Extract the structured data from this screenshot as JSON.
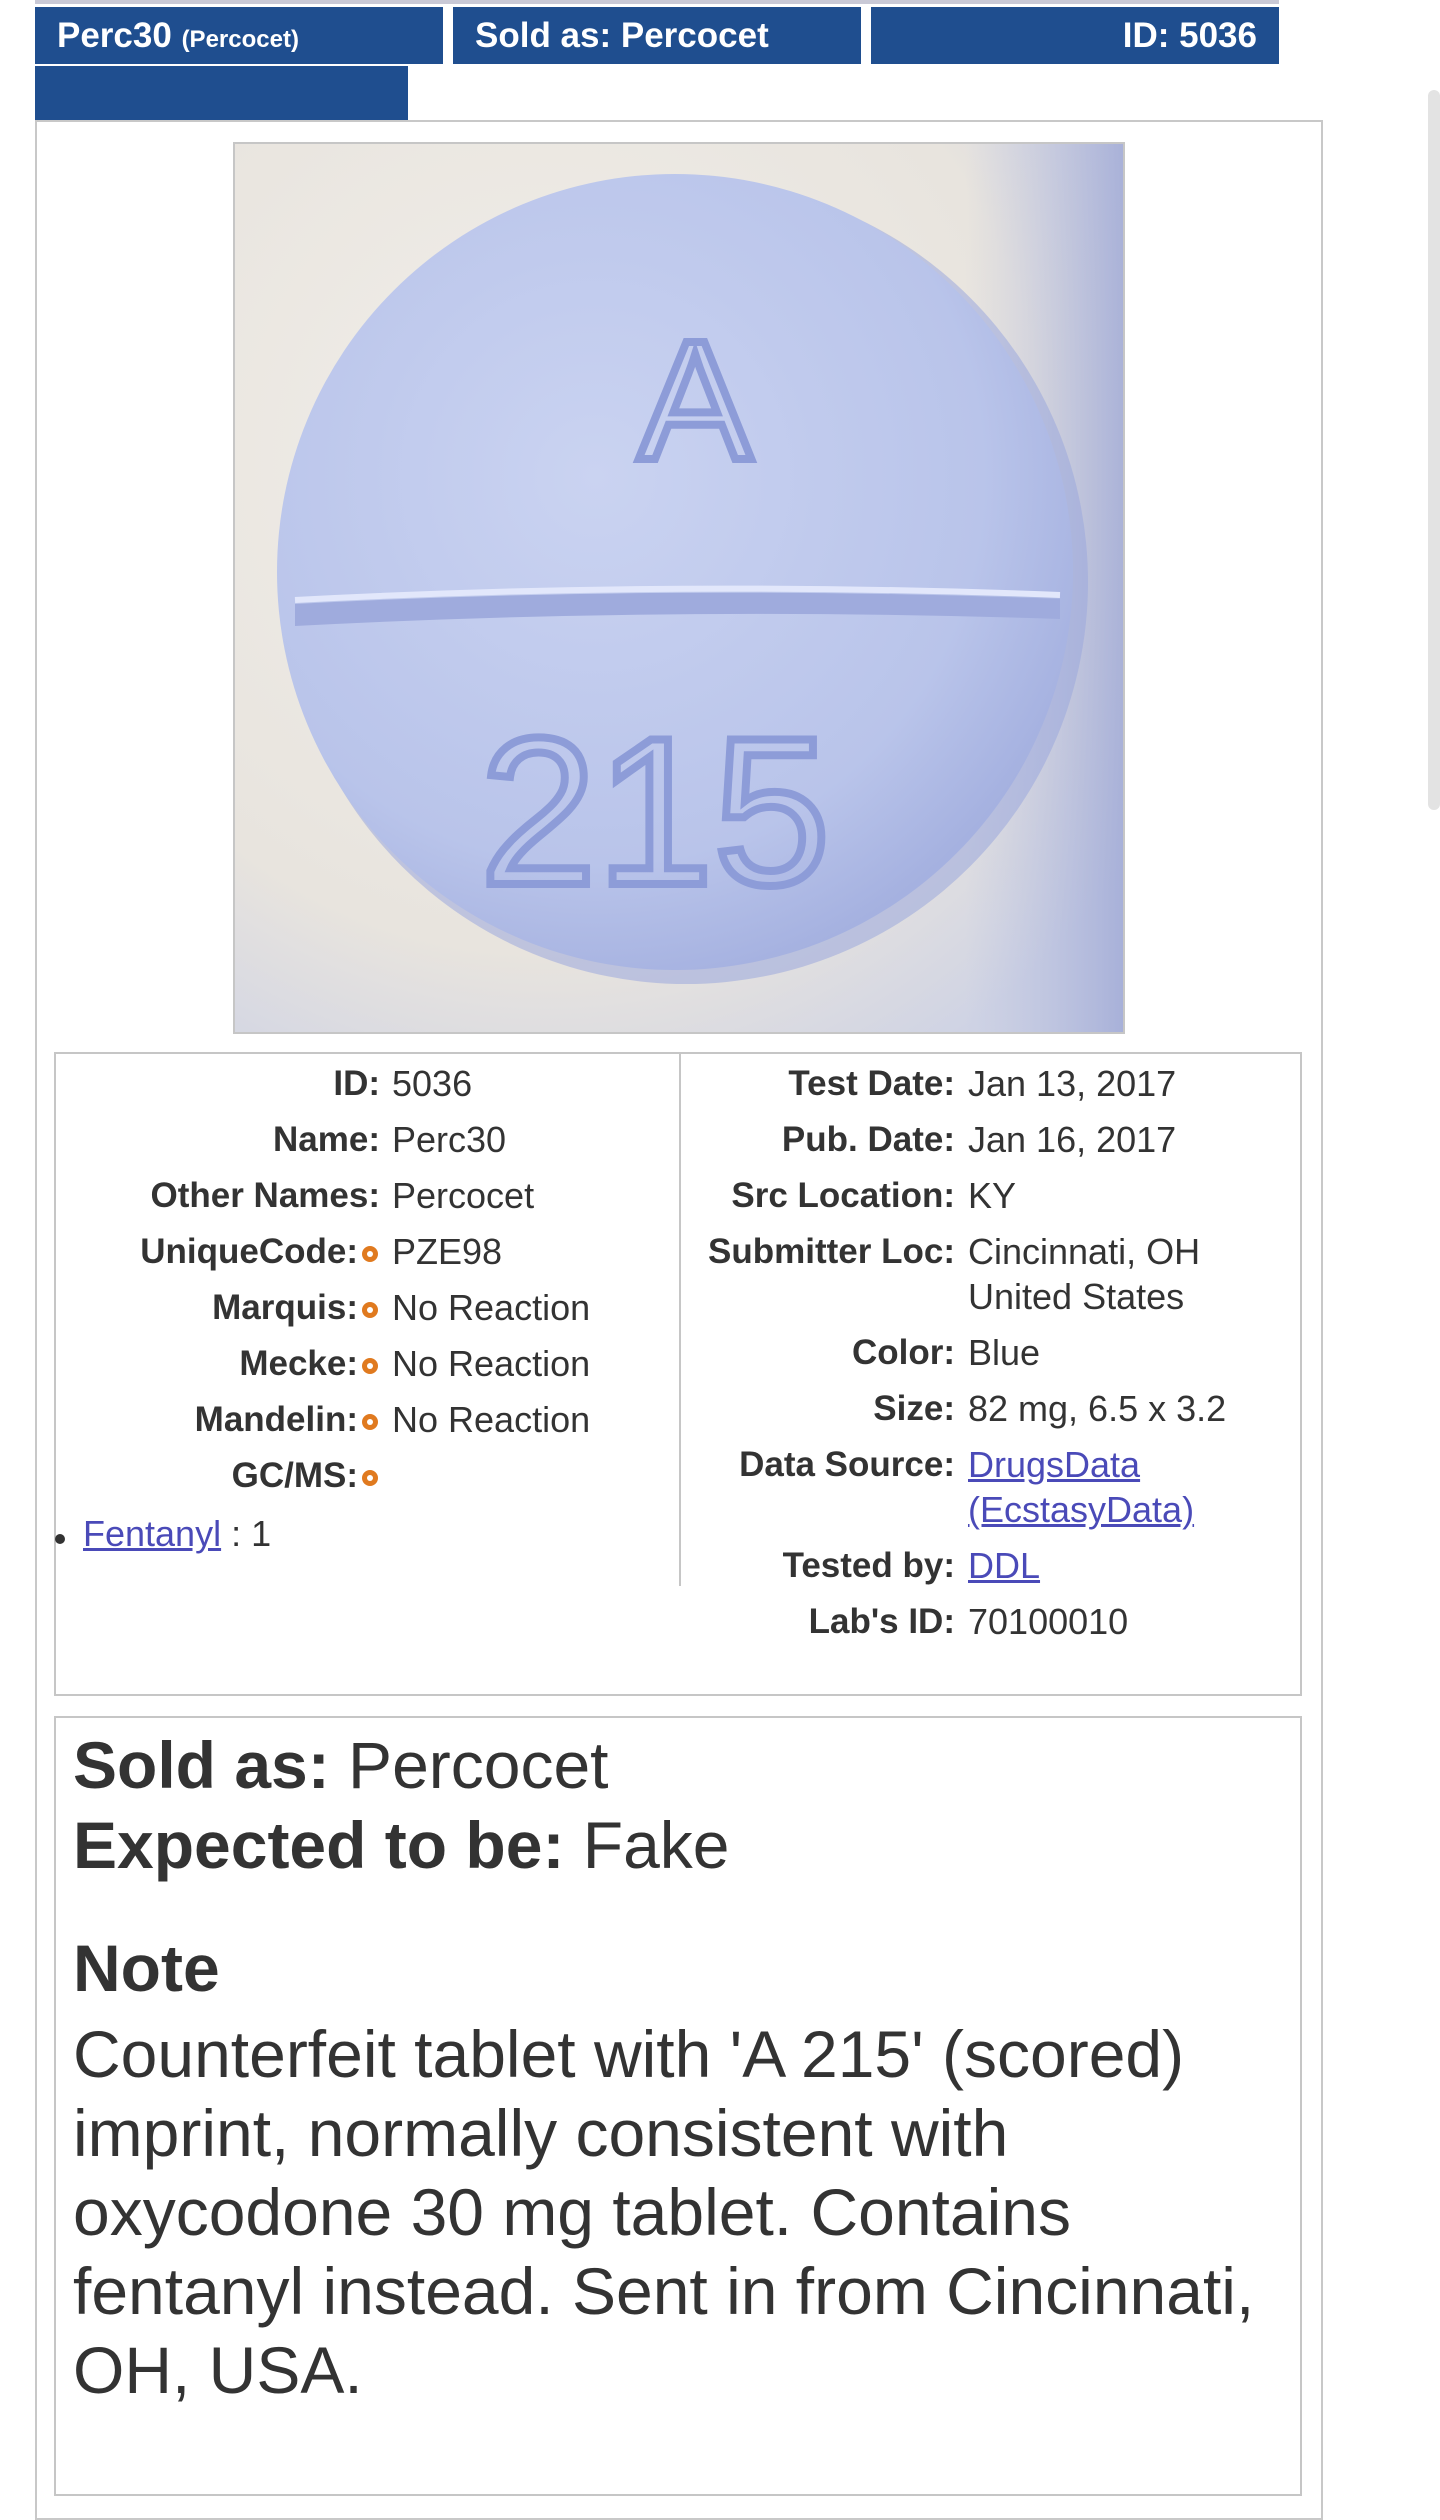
{
  "header": {
    "name": "Perc30",
    "name_alias": "(Percocet)",
    "sold_as": "Sold as: Percocet",
    "id": "ID: 5036"
  },
  "photo": {
    "imprint_top": "A",
    "imprint_bottom": "215",
    "colors": {
      "tablet": "#bfc9ee",
      "imprint": "#8f9ed8",
      "background": "#ece8e2"
    }
  },
  "details_left": [
    {
      "label": "ID:",
      "value": "5036"
    },
    {
      "label": "Name:",
      "value": "Perc30"
    },
    {
      "label": "Other Names:",
      "value": "Percocet"
    },
    {
      "label": "UniqueCode:",
      "value": "PZE98"
    },
    {
      "label": "Marquis:",
      "value": "No Reaction"
    },
    {
      "label": "Mecke:",
      "value": "No Reaction"
    },
    {
      "label": "Mandelin:",
      "value": "No Reaction"
    },
    {
      "label": "GC/MS:",
      "value": ""
    }
  ],
  "gcms_results": [
    {
      "substance": "Fentanyl",
      "amount": " : 1"
    }
  ],
  "details_right": {
    "test_date": {
      "label": "Test Date:",
      "value": "Jan 13, 2017"
    },
    "pub_date": {
      "label": "Pub. Date:",
      "value": "Jan 16, 2017"
    },
    "src_location": {
      "label": "Src Location:",
      "value": "KY"
    },
    "submitter_loc": {
      "label": "Submitter Loc:",
      "line1": "Cincinnati, OH",
      "line2": "United States"
    },
    "color": {
      "label": "Color:",
      "value": "Blue"
    },
    "size": {
      "label": "Size:",
      "value": "82 mg, 6.5 x 3.2"
    },
    "data_source": {
      "label": "Data Source:",
      "line1": "DrugsData",
      "line2": "(EcstasyData)"
    },
    "tested_by": {
      "label": "Tested by:",
      "value": "DDL"
    },
    "labs_id": {
      "label": "Lab's ID:",
      "value": "70100010"
    }
  },
  "summary": {
    "sold_as_label": "Sold as:",
    "sold_as_value": " Percocet",
    "expected_label": "Expected to be:",
    "expected_value": " Fake",
    "note_title": "Note",
    "note_text": "Counterfeit tablet with 'A 215' (scored) imprint, normally consistent with oxycodone 30 mg tablet. Contains fentanyl instead. Sent in from Cincinnati, OH, USA."
  },
  "colors": {
    "tab_bg": "#1f4e8f",
    "link": "#4a4ab8",
    "info_dot": "#e07a1f"
  }
}
